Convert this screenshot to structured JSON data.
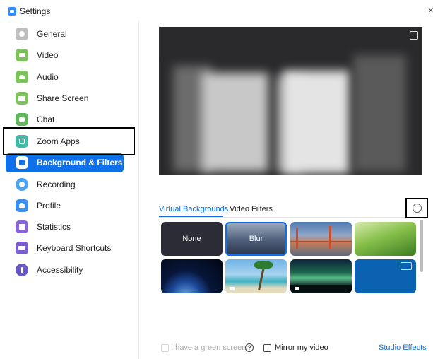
{
  "window": {
    "title": "Settings",
    "close_glyph": "×"
  },
  "sidebar": {
    "items": [
      {
        "label": "General",
        "icon": "gear-icon",
        "color": "#bdbdbd"
      },
      {
        "label": "Video",
        "icon": "video-camera-icon",
        "color": "#7cc35a"
      },
      {
        "label": "Audio",
        "icon": "headphones-icon",
        "color": "#7cc35a"
      },
      {
        "label": "Share Screen",
        "icon": "share-screen-icon",
        "color": "#7cc35a"
      },
      {
        "label": "Chat",
        "icon": "chat-bubble-icon",
        "color": "#5fb95b"
      },
      {
        "label": "Zoom Apps",
        "icon": "apps-icon",
        "color": "#46b8a6"
      },
      {
        "label": "Background & Filters",
        "icon": "background-icon",
        "color": "#0e71eb",
        "active": true
      },
      {
        "label": "Recording",
        "icon": "record-icon",
        "color": "#4aa3f5"
      },
      {
        "label": "Profile",
        "icon": "person-icon",
        "color": "#3a8ff0"
      },
      {
        "label": "Statistics",
        "icon": "statistics-icon",
        "color": "#8b63d9"
      },
      {
        "label": "Keyboard Shortcuts",
        "icon": "keyboard-icon",
        "color": "#7b5fd2"
      },
      {
        "label": "Accessibility",
        "icon": "accessibility-icon",
        "color": "#6a57c8"
      }
    ]
  },
  "tabs": {
    "virtual_backgrounds": "Virtual Backgrounds",
    "video_filters": "Video Filters",
    "active": "Virtual Backgrounds"
  },
  "backgrounds": {
    "none_label": "None",
    "blur_label": "Blur",
    "selected": "Blur",
    "items": [
      "none",
      "blur",
      "golden-gate-bridge",
      "grass",
      "earth-from-space",
      "beach-palm",
      "aurora",
      "blue-solid"
    ]
  },
  "footer": {
    "green_screen_label": "I have a green screen",
    "green_screen_checked": false,
    "green_screen_disabled": true,
    "mirror_label": "Mirror my video",
    "mirror_checked": false,
    "studio_effects": "Studio Effects"
  },
  "colors": {
    "accent": "#0e71eb"
  }
}
